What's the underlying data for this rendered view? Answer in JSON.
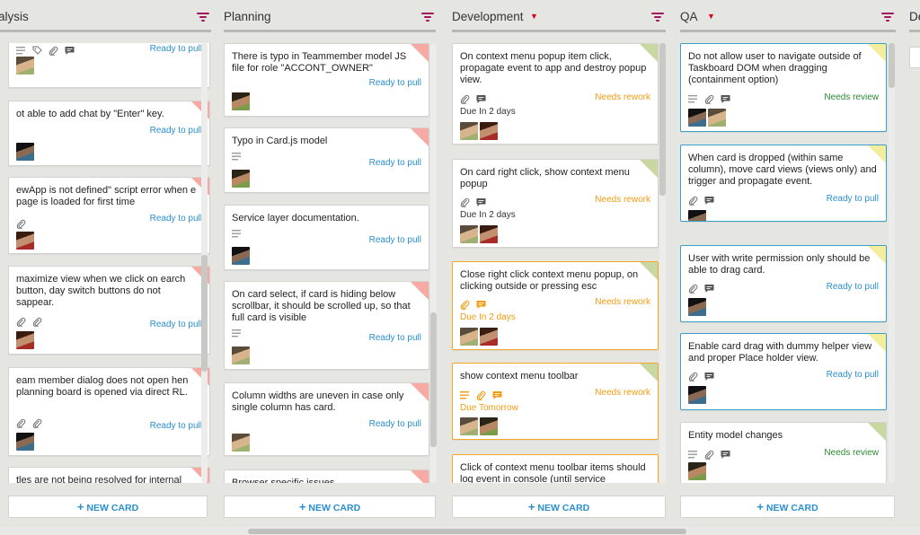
{
  "board": {
    "new_card_label": "NEW CARD",
    "columns": [
      {
        "title": "alysis",
        "has_caret": false,
        "cards": [
          {
            "title": "",
            "status": "Ready to pull",
            "status_type": "pull",
            "corner": "none",
            "due": "",
            "icons": [
              "lines-icon",
              "tag-icon",
              "paperclip-icon",
              "comment-icon"
            ],
            "avatars": [
              "d"
            ]
          },
          {
            "title": "ot able to add chat by \"Enter\" key.",
            "status": "Ready to pull",
            "status_type": "pull",
            "corner": "red",
            "due": "",
            "icons": [],
            "avatars": [
              "c"
            ]
          },
          {
            "title": "ewApp is not defined\" script error when e page is loaded for first time",
            "status": "Ready to pull",
            "status_type": "pull",
            "corner": "red",
            "due": "",
            "icons": [
              "paperclip-icon"
            ],
            "avatars": [
              "b"
            ]
          },
          {
            "title": " maximize view when we click on earch button, day switch buttons do not sappear.",
            "status": "Ready to pull",
            "status_type": "pull",
            "corner": "red",
            "due": "",
            "icons": [
              "paperclip-icon",
              "paperclip-icon"
            ],
            "avatars": [
              "b"
            ]
          },
          {
            "title": "eam member dialog does not open hen planning board is opened via direct RL.",
            "status": "Ready to pull",
            "status_type": "pull",
            "corner": "red",
            "due": "",
            "icons": [
              "paperclip-icon",
              "paperclip-icon"
            ],
            "avatars": [
              "c"
            ]
          },
          {
            "title": "tles are not being resolved for internal",
            "status": "",
            "status_type": "pull",
            "corner": "red",
            "due": "",
            "icons": [],
            "avatars": []
          }
        ]
      },
      {
        "title": "Planning",
        "has_caret": false,
        "cards": [
          {
            "title": "There is typo in Teammember model JS file for role \"ACCONT_OWNER\"",
            "status": "Ready to pull",
            "status_type": "pull",
            "corner": "red",
            "due": "",
            "icons": [],
            "avatars": [
              "a"
            ]
          },
          {
            "title": "Typo in Card.js model",
            "status": "Ready to pull",
            "status_type": "pull",
            "corner": "red",
            "due": "",
            "icons": [
              "lines-icon"
            ],
            "avatars": [
              "a"
            ]
          },
          {
            "title": "Service layer documentation.",
            "status": "Ready to pull",
            "status_type": "pull",
            "corner": "none",
            "due": "",
            "icons": [
              "lines-icon"
            ],
            "avatars": [
              "c"
            ]
          },
          {
            "title": "On card select, if card is hiding below scrollbar, it should be scrolled up, so that full card is visible",
            "status": "Ready to pull",
            "status_type": "pull",
            "corner": "red",
            "due": "",
            "icons": [
              "lines-icon"
            ],
            "avatars": [
              "d"
            ]
          },
          {
            "title": "Column widths are uneven in case only single column has card.",
            "status": "Ready to pull",
            "status_type": "pull",
            "corner": "red",
            "due": "",
            "icons": [],
            "avatars": [
              "d"
            ]
          },
          {
            "title": "Browser specific issues",
            "status": "",
            "status_type": "pull",
            "corner": "red",
            "due": "",
            "icons": [],
            "avatars": []
          }
        ]
      },
      {
        "title": "Development",
        "has_caret": true,
        "cards": [
          {
            "title": "On context menu popup item click, propagate event to app and destroy popup view.",
            "status": "Needs rework",
            "status_type": "rework",
            "corner": "green",
            "due": "Due In 2 days",
            "due_late": false,
            "icons": [
              "paperclip-icon",
              "comment-icon"
            ],
            "avatars": [
              "d",
              "b"
            ]
          },
          {
            "title": "On card right click, show context menu popup",
            "status": "Needs rework",
            "status_type": "rework",
            "corner": "green",
            "due": "Due In 2 days",
            "due_late": false,
            "icons": [
              "paperclip-icon",
              "comment-icon"
            ],
            "avatars": [
              "d",
              "b"
            ]
          },
          {
            "title": "Close right click context menu popup, on clicking outside or pressing esc",
            "status": "Needs rework",
            "status_type": "rework",
            "corner": "green",
            "due": "Due In 2 days",
            "due_late": true,
            "icons": [
              "paperclip-icon",
              "comment-icon"
            ],
            "avatars": [
              "d",
              "b"
            ],
            "highlight": "amber"
          },
          {
            "title": "show context menu toolbar",
            "status": "Needs rework",
            "status_type": "rework",
            "corner": "green",
            "due": "Due Tomorrow",
            "due_late": true,
            "icons": [
              "lines-icon",
              "paperclip-icon",
              "comment-icon"
            ],
            "avatars": [
              "d",
              "a"
            ],
            "highlight": "amber"
          },
          {
            "title": "Click of context menu toolbar items should log event in console (until service",
            "status": "",
            "status_type": "rework",
            "corner": "none",
            "due": "",
            "icons": [],
            "avatars": [],
            "highlight": "amber"
          }
        ]
      },
      {
        "title": "QA",
        "has_caret": true,
        "cards": [
          {
            "title": "Do not allow user to navigate outside of Taskboard DOM when dragging (containment option)",
            "status": "Needs review",
            "status_type": "review",
            "corner": "yellow",
            "due": "",
            "icons": [
              "lines-icon",
              "paperclip-icon",
              "comment-icon"
            ],
            "avatars": [
              "c",
              "d"
            ],
            "highlight": "blue"
          },
          {
            "title": "When card is dropped (within same column), move card views (views only) and trigger and propagate event.",
            "status": "Ready to pull",
            "status_type": "pull",
            "corner": "yellow",
            "due": "",
            "icons": [
              "paperclip-icon",
              "comment-icon"
            ],
            "avatars": [
              "c"
            ],
            "highlight": "blue"
          },
          {
            "title": "User with write permission only should be able to drag card.",
            "status": "Ready to pull",
            "status_type": "pull",
            "corner": "yellow",
            "due": "",
            "icons": [
              "paperclip-icon",
              "comment-icon"
            ],
            "avatars": [
              "c"
            ],
            "highlight": "blue"
          },
          {
            "title": "Enable card drag with dummy helper view and proper Place holder view.",
            "status": "Ready to pull",
            "status_type": "pull",
            "corner": "yellow",
            "due": "",
            "icons": [
              "paperclip-icon",
              "comment-icon"
            ],
            "avatars": [
              "c"
            ],
            "highlight": "blue"
          },
          {
            "title": "Entity model changes",
            "status": "Needs review",
            "status_type": "review",
            "corner": "green",
            "due": "",
            "icons": [
              "lines-icon",
              "paperclip-icon",
              "comment-icon"
            ],
            "avatars": [
              "a"
            ]
          }
        ]
      },
      {
        "title": "De",
        "has_caret": false,
        "cards": []
      }
    ],
    "colors": {
      "background": "#e5e5e2",
      "link_blue": "#2a8fd0",
      "rework_orange": "#f39c12",
      "review_green": "#2a8a32",
      "filter_magenta": "#a3135e",
      "caret_red": "#d0021b"
    }
  }
}
